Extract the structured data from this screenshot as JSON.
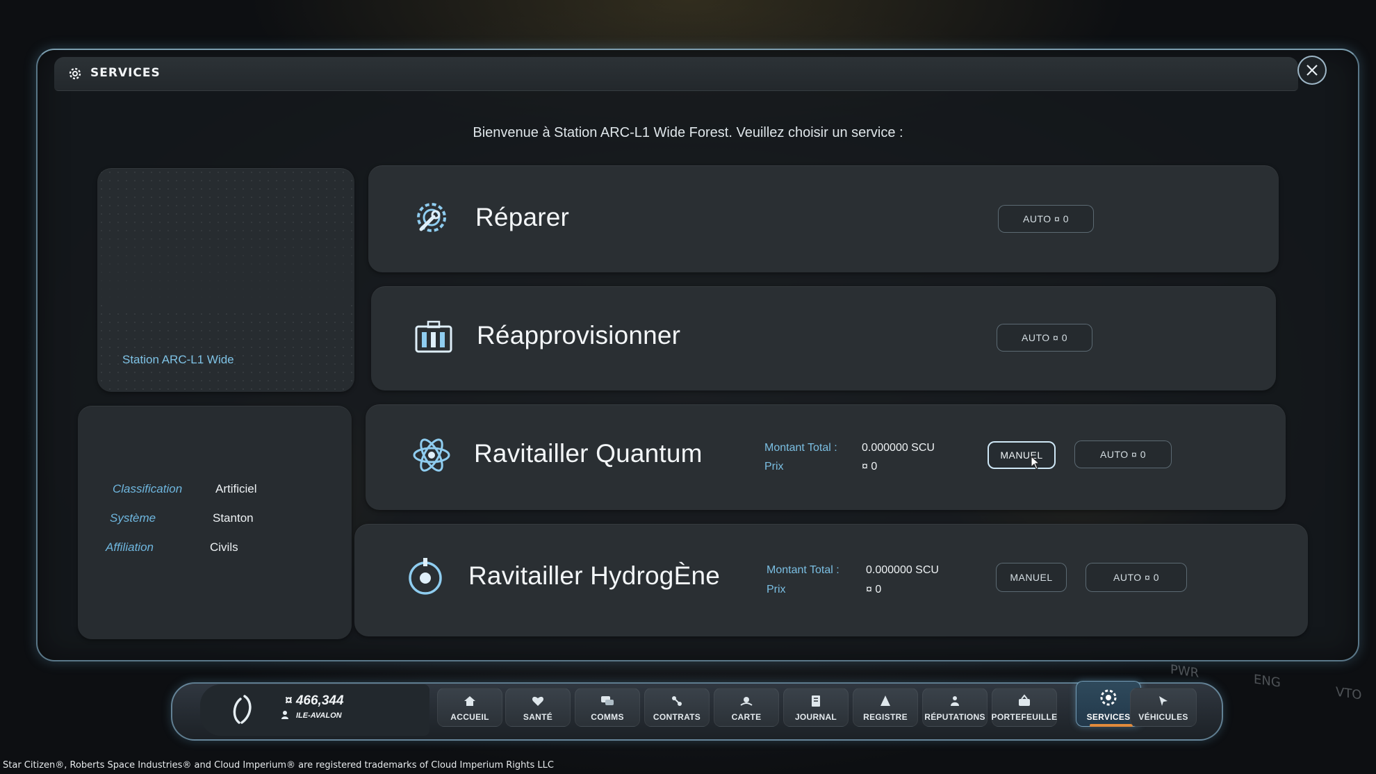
{
  "window": {
    "title": "SERVICES",
    "close_icon": "close-icon"
  },
  "welcome_text": "Bienvenue à Station ARC-L1 Wide Forest. Veuillez choisir un service :",
  "location": {
    "name": "Station ARC-L1 Wide",
    "info": [
      {
        "label": "Classification",
        "value": "Artificiel"
      },
      {
        "label": "Système",
        "value": "Stanton"
      },
      {
        "label": "Affiliation",
        "value": "Civils"
      }
    ]
  },
  "services": [
    {
      "title": "Réparer",
      "icon": "wrench-gear-icon",
      "auto_label": "AUTO ¤ 0"
    },
    {
      "title": "Réapprovisionner",
      "icon": "ammo-crate-icon",
      "auto_label": "AUTO ¤ 0"
    },
    {
      "title": "Ravitailler Quantum",
      "icon": "atom-icon",
      "amount_label": "Montant Total :",
      "amount_value": "0.000000 SCU",
      "price_label": "Prix",
      "price_value": "¤ 0",
      "manual_label": "MANUEL",
      "auto_label": "AUTO ¤ 0"
    },
    {
      "title": "Ravitailler HydrogÈne",
      "icon": "hydrogen-icon",
      "amount_label": "Montant Total :",
      "amount_value": "0.000000 SCU",
      "price_label": "Prix",
      "price_value": "¤ 0",
      "manual_label": "MANUEL",
      "auto_label": "AUTO ¤ 0"
    }
  ],
  "player": {
    "credits": "¤ 466,344",
    "name": "ILE-AVALON"
  },
  "nav": [
    {
      "label": "ACCUEIL",
      "icon": "home-icon"
    },
    {
      "label": "SANTÉ",
      "icon": "heart-icon"
    },
    {
      "label": "COMMS",
      "icon": "chat-icon"
    },
    {
      "label": "CONTRATS",
      "icon": "contracts-icon"
    },
    {
      "label": "CARTE",
      "icon": "map-icon"
    },
    {
      "label": "JOURNAL",
      "icon": "journal-icon"
    },
    {
      "label": "REGISTRE",
      "icon": "registry-icon"
    },
    {
      "label": "RÉPUTATIONS",
      "icon": "reputation-icon"
    },
    {
      "label": "PORTEFEUILLE",
      "icon": "wallet-icon"
    },
    {
      "label": "SERVICES",
      "icon": "services-icon",
      "active": true
    },
    {
      "label": "VÉHICULES",
      "icon": "vehicle-icon"
    }
  ],
  "hud": {
    "pwr": "PWR",
    "enc": "ENG",
    "vto": "VTO"
  },
  "footer": "Star Citizen®, Roberts Space Industries® and Cloud Imperium® are registered trademarks of Cloud Imperium Rights LLC",
  "colors": {
    "accent": "#7fc3e6",
    "active_tab": "#e08a3c",
    "panel": "#2a2f33"
  }
}
